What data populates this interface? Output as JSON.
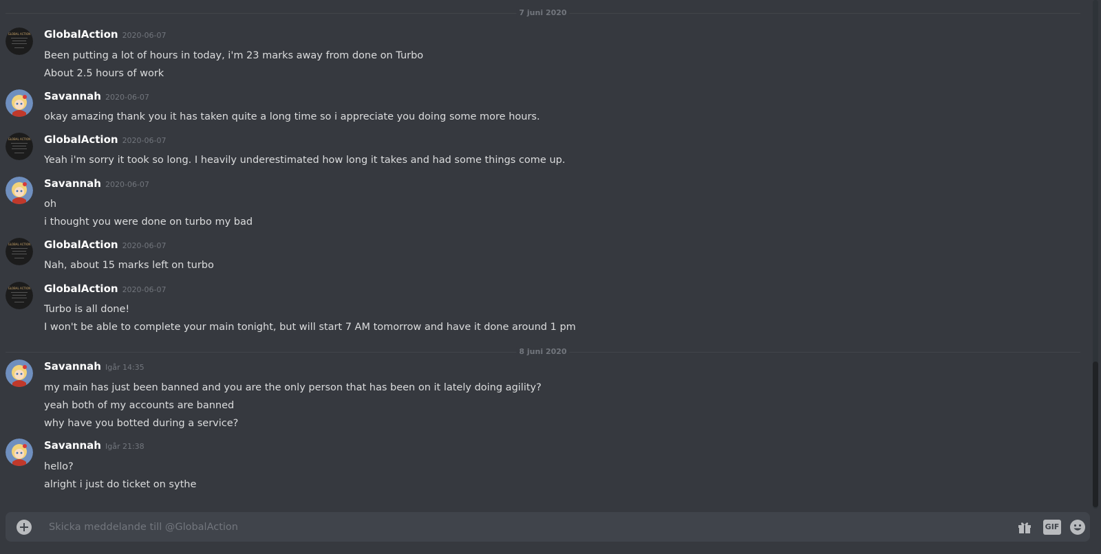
{
  "chat": {
    "dividers": [
      "7 juni 2020",
      "8 juni 2020"
    ],
    "messages": [
      {
        "author": "GlobalAction",
        "timestamp": "2020-06-07",
        "lines": [
          "Been putting a lot of hours in today, i'm 23 marks away from done on Turbo",
          "About 2.5 hours of work"
        ]
      },
      {
        "author": "Savannah",
        "timestamp": "2020-06-07",
        "lines": [
          "okay amazing thank you it has taken quite a long time so i appreciate you doing some more hours."
        ]
      },
      {
        "author": "GlobalAction",
        "timestamp": "2020-06-07",
        "lines": [
          "Yeah i'm sorry it took so long. I heavily underestimated how long it takes and had some things come up."
        ]
      },
      {
        "author": "Savannah",
        "timestamp": "2020-06-07",
        "lines": [
          "oh",
          "i thought you were done on turbo my bad"
        ]
      },
      {
        "author": "GlobalAction",
        "timestamp": "2020-06-07",
        "lines": [
          "Nah, about 15 marks left on turbo"
        ]
      },
      {
        "author": "GlobalAction",
        "timestamp": "2020-06-07",
        "lines": [
          "Turbo is all done!",
          "I won't be able to complete your main tonight, but will start 7 AM tomorrow and have it done around 1 pm"
        ]
      },
      {
        "author": "Savannah",
        "timestamp": "Igår 14:35",
        "lines": [
          "my main has just been banned and you are the only person that has been on it lately doing agility?",
          "yeah both of my accounts are banned",
          "why have you botted during a service?"
        ]
      },
      {
        "author": "Savannah",
        "timestamp": "Igår 21:38",
        "lines": [
          "hello?",
          "alright i just do ticket on sythe"
        ]
      }
    ]
  },
  "avatars": {
    "GlobalAction": {
      "logo_text": "GLOBAL ACTION",
      "icon": "globalaction-logo-avatar"
    },
    "Savannah": {
      "icon": "anime-character-avatar"
    }
  },
  "composer": {
    "placeholder": "Skicka meddelande till @GlobalAction",
    "gif_label": "GIF"
  },
  "colors": {
    "background": "#36393f",
    "composer": "#40444b",
    "username": "#ffffff",
    "timestamp": "#72767d",
    "text": "#dcddde"
  }
}
